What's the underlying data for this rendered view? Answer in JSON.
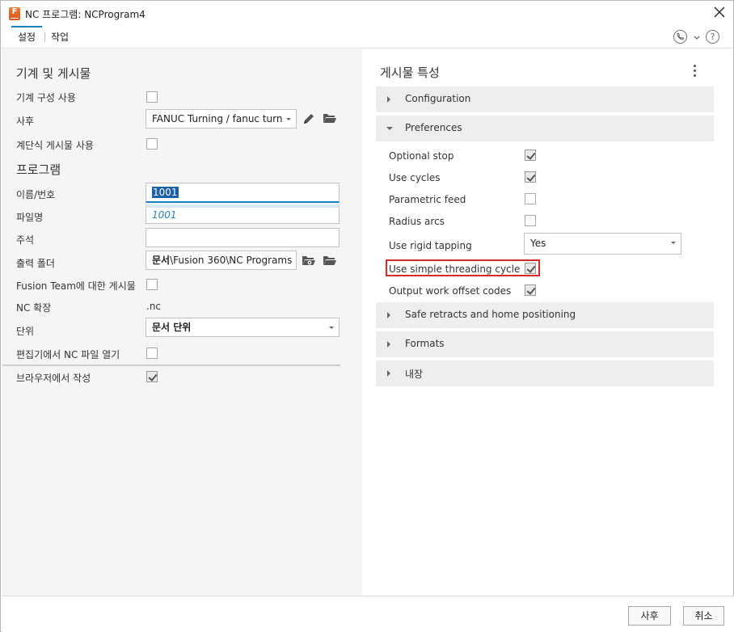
{
  "window": {
    "title": "NC 프로그램: NCProgram4",
    "app_icon_letter": "F"
  },
  "tabs": [
    {
      "label": "설정"
    },
    {
      "label": "작업"
    }
  ],
  "left": {
    "section1_title": "기계 및 게시물",
    "machine_config_label": "기계 구성 사용",
    "machine_config_checked": false,
    "post_label": "사후",
    "post_value": "FANUC Turning / fanuc turn",
    "cascade_label": "계단식 게시물 사용",
    "cascade_checked": false,
    "section2_title": "프로그램",
    "name_label": "이름/번호",
    "name_value": "1001",
    "filename_label": "파일명",
    "filename_value": "1001",
    "comment_label": "주석",
    "comment_value": "",
    "output_folder_label": "출력 폴더",
    "output_folder_value_bold": "문서",
    "output_folder_value_rest": "\\Fusion 360\\NC Programs",
    "fusion_team_label": "Fusion Team에 대한 게시물",
    "fusion_team_checked": false,
    "nc_ext_label": "NC 확장",
    "nc_ext_value": ".nc",
    "unit_label": "단위",
    "unit_value": "문서 단위",
    "open_editor_label": "편집기에서 NC 파일 열기",
    "open_editor_checked": false,
    "browser_label": "브라우저에서 작성",
    "browser_checked": true
  },
  "right": {
    "title": "게시물 특성",
    "groups": {
      "configuration": "Configuration",
      "preferences": "Preferences",
      "safe_retracts": "Safe retracts and home positioning",
      "formats": "Formats",
      "builtin": "내장"
    },
    "prefs": [
      {
        "label": "Optional stop",
        "checked": true
      },
      {
        "label": "Use cycles",
        "checked": true
      },
      {
        "label": "Parametric feed",
        "checked": false
      },
      {
        "label": "Radius arcs",
        "checked": false
      },
      {
        "label": "Use rigid tapping",
        "value": "Yes"
      },
      {
        "label": "Use simple threading cycle",
        "checked": true
      },
      {
        "label": "Output work offset codes",
        "checked": true
      }
    ],
    "highlight_color": "#d62b2b"
  },
  "buttons": {
    "post": "사후",
    "cancel": "취소"
  },
  "icons": [
    "app-icon",
    "close-icon",
    "phone-icon",
    "chevron-down-icon",
    "help-icon",
    "pencil-icon",
    "folder-icon",
    "folder-settings-icon",
    "more-vertical-icon",
    "chevron-right-icon"
  ]
}
